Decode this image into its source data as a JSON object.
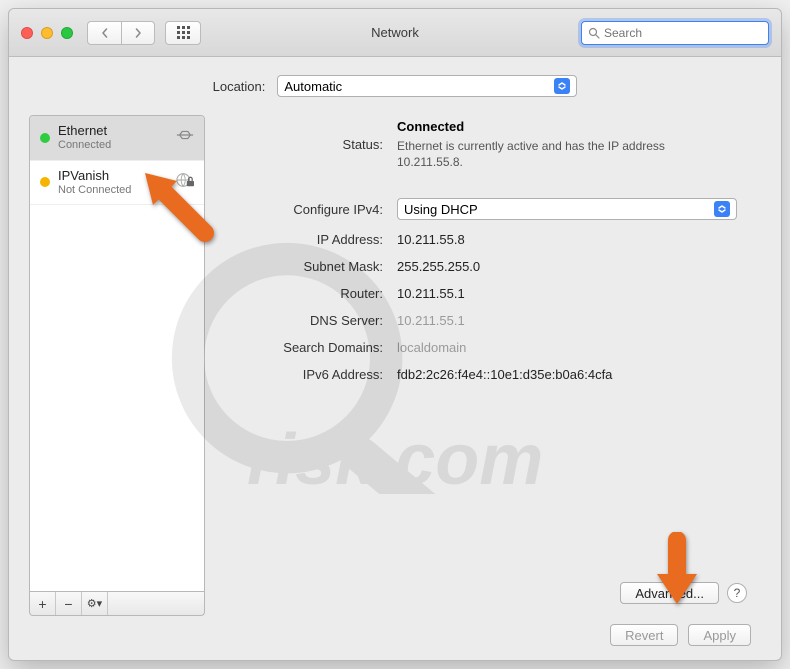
{
  "window": {
    "title": "Network"
  },
  "toolbar": {
    "back_icon": "chevron-left",
    "forward_icon": "chevron-right",
    "grid_icon": "apps-grid"
  },
  "search": {
    "placeholder": "Search",
    "value": ""
  },
  "location": {
    "label": "Location:",
    "selected": "Automatic"
  },
  "sidebar": {
    "items": [
      {
        "name": "Ethernet",
        "status": "Connected",
        "dot": "green",
        "icon": "ethernet-icon",
        "selected": true
      },
      {
        "name": "IPVanish",
        "status": "Not Connected",
        "dot": "yellow",
        "icon": "globe-lock-icon",
        "selected": false
      }
    ],
    "toolbar": {
      "add": "+",
      "remove": "−",
      "actions": "⚙︎▾"
    }
  },
  "details": {
    "status_label": "Status:",
    "status_value": "Connected",
    "status_desc": "Ethernet is currently active and has the IP address 10.211.55.8.",
    "configure_label": "Configure IPv4:",
    "configure_value": "Using DHCP",
    "ip_label": "IP Address:",
    "ip_value": "10.211.55.8",
    "subnet_label": "Subnet Mask:",
    "subnet_value": "255.255.255.0",
    "router_label": "Router:",
    "router_value": "10.211.55.1",
    "dns_label": "DNS Server:",
    "dns_value": "10.211.55.1",
    "search_label": "Search Domains:",
    "search_value": "localdomain",
    "ipv6_label": "IPv6 Address:",
    "ipv6_value": "fdb2:2c26:f4e4::10e1:d35e:b0a6:4cfa"
  },
  "buttons": {
    "advanced": "Advanced...",
    "help": "?",
    "revert": "Revert",
    "apply": "Apply"
  },
  "annotations": {
    "arrow_color": "#e96b1f",
    "watermark_text": "pcrisk.com"
  }
}
